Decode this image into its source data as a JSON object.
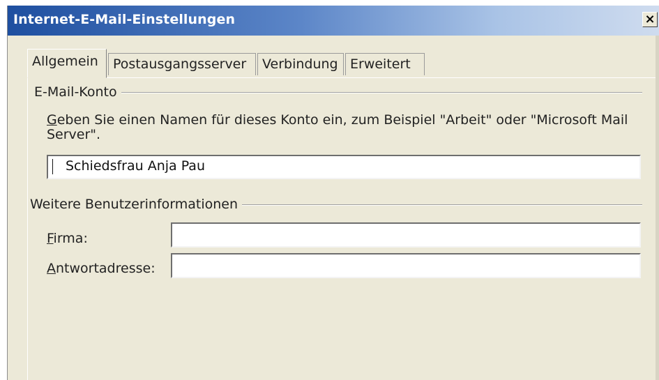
{
  "window": {
    "title": "Internet-E-Mail-Einstellungen",
    "close_glyph": "×"
  },
  "tabs": [
    {
      "label": "Allgemein",
      "active": true
    },
    {
      "label": "Postausgangsserver",
      "active": false
    },
    {
      "label": "Verbindung",
      "active": false
    },
    {
      "label": "Erweitert",
      "active": false
    }
  ],
  "account_group": {
    "label": "E-Mail-Konto",
    "description_line1_mnemonic": "G",
    "description_line1_rest": "eben Sie einen Namen für dieses Konto ein, zum Beispiel \"Arbeit\" oder \"Microsoft Mail",
    "description_line2": "Server\".",
    "account_name_value": "Schiedsfrau Anja Pau"
  },
  "user_info_group": {
    "label": "Weitere Benutzerinformationen",
    "company_label_mnemonic": "F",
    "company_label_rest": "irma:",
    "company_value": "",
    "reply_label_mnemonic": "A",
    "reply_label_rest": "ntwortadresse:",
    "reply_value": ""
  },
  "icons": {
    "close": "close-icon"
  }
}
